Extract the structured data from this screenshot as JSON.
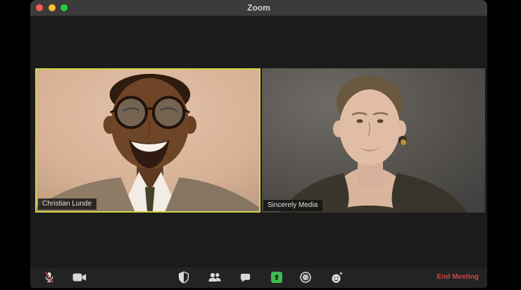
{
  "window": {
    "title": "Zoom"
  },
  "titlebar": {
    "traffic_lights": [
      {
        "name": "close",
        "color": "#f55b51"
      },
      {
        "name": "minimize",
        "color": "#fdbd2e"
      },
      {
        "name": "maximize",
        "color": "#27c93f"
      }
    ]
  },
  "participants": [
    {
      "name": "Christian Lunde",
      "active_speaker": true,
      "video_on": true
    },
    {
      "name": "Sincerely Media",
      "active_speaker": false,
      "video_on": true
    }
  ],
  "toolbar": {
    "buttons": [
      {
        "id": "mute",
        "icon": "microphone-muted-icon",
        "state": "muted"
      },
      {
        "id": "video",
        "icon": "video-camera-icon",
        "state": "on"
      },
      {
        "id": "security",
        "icon": "security-shield-icon"
      },
      {
        "id": "participants",
        "icon": "participants-icon"
      },
      {
        "id": "chat",
        "icon": "chat-bubble-icon"
      },
      {
        "id": "share-screen",
        "icon": "share-screen-arrow-icon",
        "accent_color": "#42b954"
      },
      {
        "id": "record",
        "icon": "record-circle-icon"
      },
      {
        "id": "reactions",
        "icon": "reactions-smiley-icon"
      }
    ],
    "end_meeting_label": "End Meeting"
  },
  "colors": {
    "active_speaker_border": "#d3d549",
    "end_meeting_text": "#d0453f",
    "titlebar_bg": "#3b3b3b",
    "window_bg": "#1b1b1b",
    "toolbar_bg": "#232323",
    "mute_slash": "#c2403a"
  }
}
